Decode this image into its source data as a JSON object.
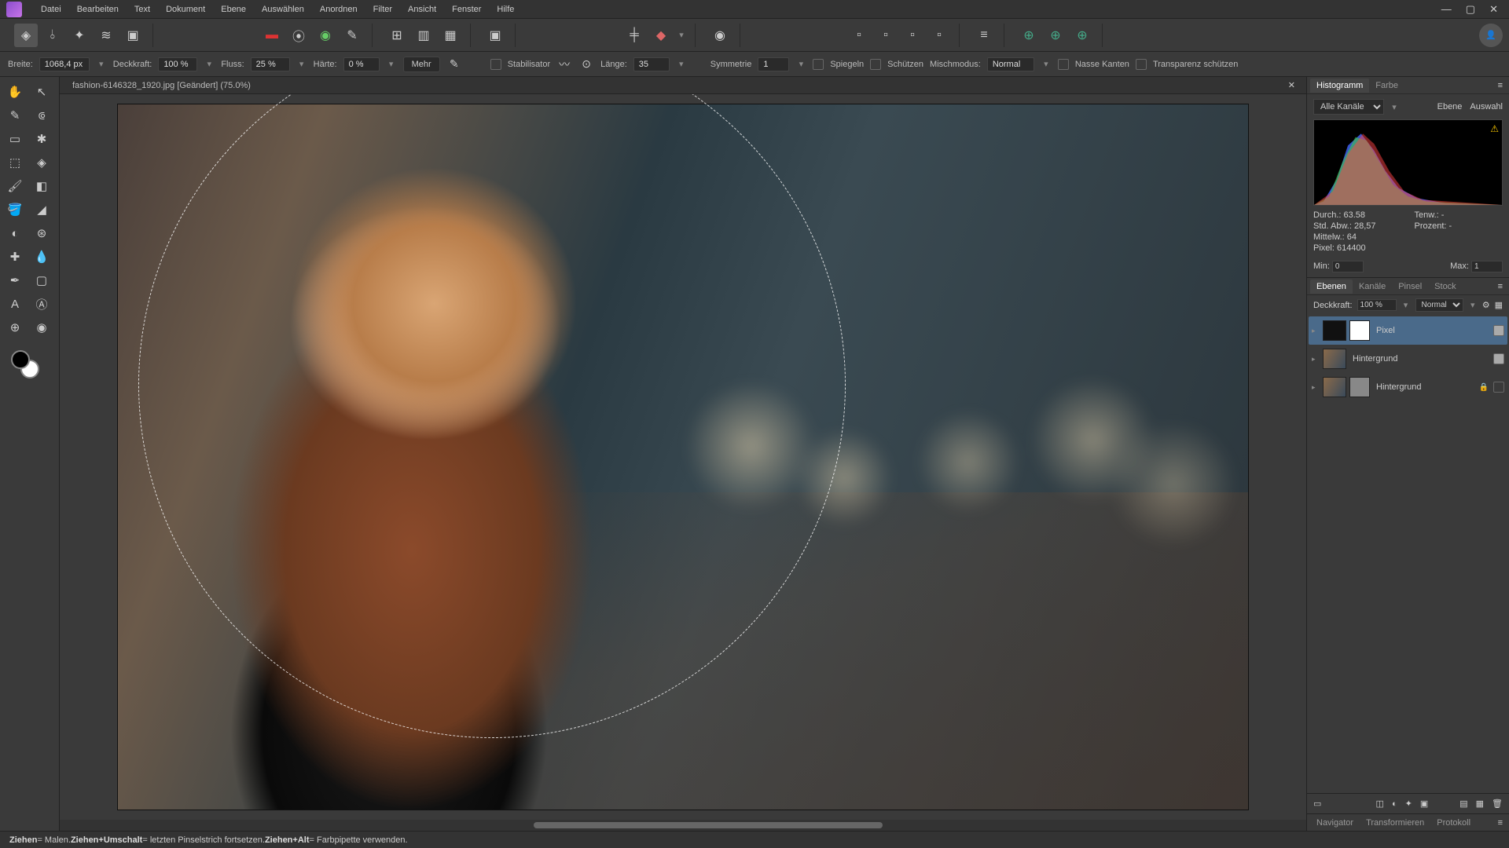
{
  "menu": {
    "items": [
      "Datei",
      "Bearbeiten",
      "Text",
      "Dokument",
      "Ebene",
      "Auswählen",
      "Anordnen",
      "Filter",
      "Ansicht",
      "Fenster",
      "Hilfe"
    ]
  },
  "doc": {
    "title": "fashion-6146328_1920.jpg [Geändert] (75.0%)"
  },
  "context": {
    "width_label": "Breite:",
    "width": "1068,4 px",
    "opacity_label": "Deckkraft:",
    "opacity": "100 %",
    "flow_label": "Fluss:",
    "flow": "25 %",
    "hardness_label": "Härte:",
    "hardness": "0 %",
    "more": "Mehr",
    "stabiliser": "Stabilisator",
    "length_label": "Länge:",
    "length": "35",
    "symmetry_label": "Symmetrie",
    "symmetry": "1",
    "mirror": "Spiegeln",
    "protect": "Schützen",
    "blend_label": "Mischmodus:",
    "blend": "Normal",
    "wet": "Nasse Kanten",
    "alpha": "Transparenz schützen"
  },
  "panels": {
    "hist_tab": "Histogramm",
    "color_tab": "Farbe",
    "channel": "Alle Kanäle",
    "layer_link": "Ebene",
    "sel_link": "Auswahl",
    "stats": {
      "mean": "Durch.: 63.58",
      "stddev": "Std. Abw.: 28,57",
      "median": "Mittelw.: 64",
      "pixels": "Pixel: 614400",
      "tendw": "Tenw.: -",
      "pct": "Prozent: -"
    },
    "min_label": "Min:",
    "min": "0",
    "max_label": "Max:",
    "max": "1",
    "layers_tab": "Ebenen",
    "channels_tab": "Kanäle",
    "brush_tab": "Pinsel",
    "stock_tab": "Stock",
    "layer_opacity_label": "Deckkraft:",
    "layer_opacity": "100 %",
    "layer_blend": "Normal",
    "layers": [
      {
        "name": "Pixel",
        "selected": true,
        "visible": true,
        "mask": "white",
        "thumb_dark": true
      },
      {
        "name": "Hintergrund",
        "selected": false,
        "visible": true,
        "mask": "none"
      },
      {
        "name": "Hintergrund",
        "selected": false,
        "visible": false,
        "mask": "grey",
        "locked": true
      }
    ],
    "nav_tab": "Navigator",
    "trans_tab": "Transformieren",
    "proto_tab": "Protokoll"
  },
  "status": {
    "drag": "Ziehen",
    "drag_desc": " = Malen. ",
    "dragshift": "Ziehen+Umschalt",
    "dragshift_desc": " = letzten Pinselstrich fortsetzen. ",
    "dragalt": "Ziehen+Alt",
    "dragalt_desc": " = Farbpipette verwenden."
  }
}
